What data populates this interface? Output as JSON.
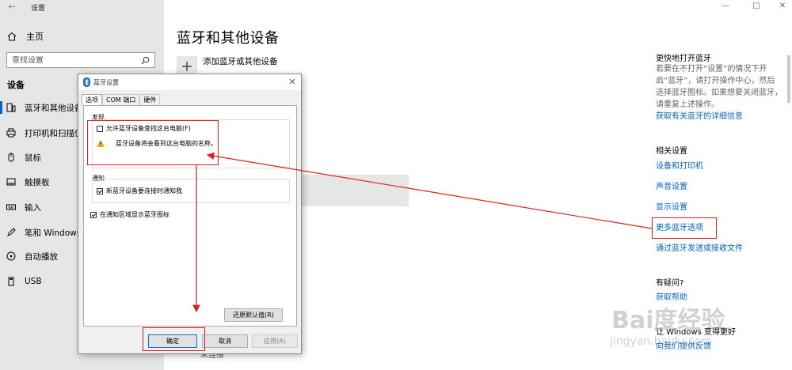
{
  "window": {
    "title": "设置",
    "back_icon": "back-arrow-icon"
  },
  "sidebar": {
    "home_label": "主页",
    "search_placeholder": "查找设置",
    "section_title": "设备",
    "items": [
      {
        "label": "蓝牙和其他设备",
        "icon": "bluetooth-devices-icon",
        "active": true
      },
      {
        "label": "打印机和扫描仪",
        "icon": "printer-icon"
      },
      {
        "label": "鼠标",
        "icon": "mouse-icon"
      },
      {
        "label": "触摸板",
        "icon": "touchpad-icon"
      },
      {
        "label": "输入",
        "icon": "keyboard-icon"
      },
      {
        "label": "笔和 Windows Ink",
        "icon": "pen-icon"
      },
      {
        "label": "自动播放",
        "icon": "autoplay-icon"
      },
      {
        "label": "USB",
        "icon": "usb-icon"
      }
    ]
  },
  "main": {
    "title": "蓝牙和其他设备",
    "add_device_label": "添加蓝牙或其他设备",
    "partial_status": "未连接"
  },
  "right_panel": {
    "quick_open_title": "更快地打开蓝牙",
    "quick_open_text": "若要在不打开“设置”的情况下开启“蓝牙”，请打开操作中心，然后选择蓝牙图标。如果想要关闭蓝牙，请重复上述操作。",
    "details_link": "获取有关蓝牙的详细信息",
    "related_title": "相关设置",
    "related_links": [
      "设备和打印机",
      "声音设置",
      "显示设置",
      "更多蓝牙选项",
      "通过蓝牙发送或接收文件"
    ],
    "question_title": "有疑问?",
    "get_help_link": "获取帮助",
    "improve_title": "让 Windows 变得更好",
    "feedback_link": "向我们提供反馈"
  },
  "dialog": {
    "title": "蓝牙设置",
    "tabs": [
      "选项",
      "COM 端口",
      "硬件"
    ],
    "discovery_label": "发现",
    "allow_discovery_label": "允许蓝牙设备查找这台电脑(F)",
    "allow_discovery_checked": false,
    "discovery_warning": "蓝牙设备将会看到这台电脑的名称。",
    "notify_label": "通知",
    "notify_new_device_label": "新蓝牙设备要连接时通知我",
    "notify_new_device_checked": true,
    "tray_icon_label": "在通知区域显示蓝牙图标",
    "tray_icon_checked": true,
    "restore_defaults_button": "还原默认值(R)",
    "ok_button": "确定",
    "cancel_button": "取消",
    "apply_button": "应用(A)"
  },
  "watermark": {
    "brand": "Bai度经验",
    "url": "jingyan.baidu.com"
  },
  "colors": {
    "accent": "#0067c0",
    "sidebar_bg": "#e6e6e6",
    "annotation_red": "#e02020"
  }
}
